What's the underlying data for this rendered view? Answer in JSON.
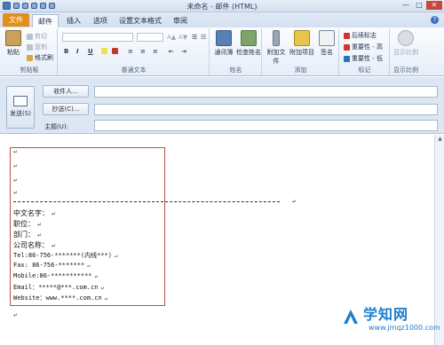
{
  "window": {
    "title": "未命名 - 邮件 (HTML)",
    "controls": [
      "—",
      "□",
      "✕"
    ]
  },
  "tabs": [
    "文件",
    "邮件",
    "插入",
    "选项",
    "设置文本格式",
    "审阅"
  ],
  "ribbon": {
    "clipboard": {
      "paste": "粘贴",
      "cut": "剪切",
      "copy": "复制",
      "format_painter": "格式刷",
      "label": "剪贴板"
    },
    "basic_text": {
      "bold": "B",
      "italic": "I",
      "underline": "U",
      "label": "普通文本"
    },
    "names": {
      "address_book": "通讯簿",
      "check_names": "检查姓名",
      "label": "姓名"
    },
    "include": {
      "attach_file": "附加文件",
      "attach_item": "附加项目",
      "signature": "签名",
      "label": "添加"
    },
    "tags": {
      "follow_up": "后续标志",
      "high_importance": "重要性 - 高",
      "low_importance": "重要性 - 低",
      "label": "标记"
    },
    "zoom": {
      "zoom": "显示比例",
      "label": "显示比例"
    }
  },
  "header": {
    "send": "发送(S)",
    "to": "收件人...",
    "cc": "抄送(C)...",
    "subject_label": "主题(U):"
  },
  "body": {
    "para_mark": "↵",
    "lines": [
      "中文名字：",
      "职位：",
      "部门：",
      "公司名称：",
      "Tel:86-756-*******(内线***)",
      "Fax: 86-756-*******",
      "Mobile:86-***********",
      "Email：*****@***.com.cn",
      "Website：www.****.com.cn"
    ]
  },
  "watermark": {
    "brand": "学知网",
    "url": "www.jmqz1000.com"
  },
  "colors": {
    "file_tab": "#e08f1a",
    "signature_border": "#b7514c",
    "watermark": "#1a7fd0"
  }
}
